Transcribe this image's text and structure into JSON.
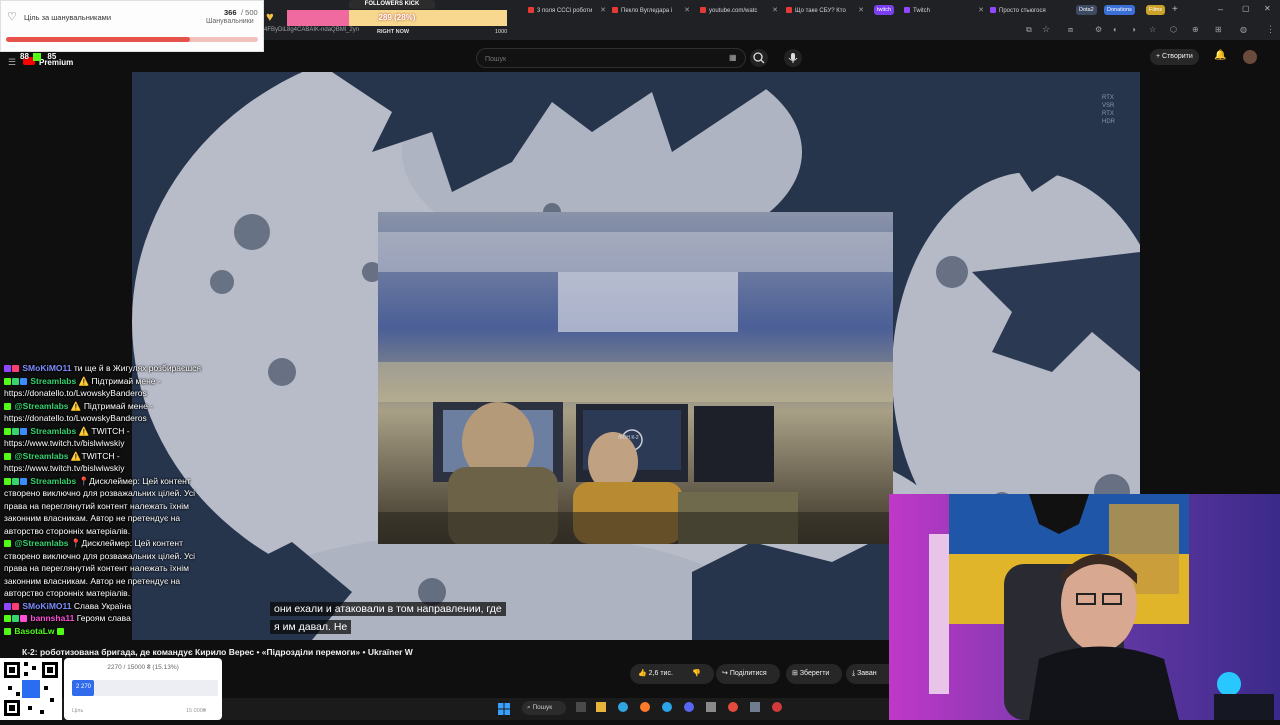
{
  "browser": {
    "tabs": [
      {
        "label": "3 поля СССі роботи",
        "icon_color": "#e53935"
      },
      {
        "label": "Пекло Вугледара і",
        "icon_color": "#e53935"
      },
      {
        "label": "youtube.com/watc",
        "icon_color": "#e53935"
      },
      {
        "label": "Що таке СБУ? Кто",
        "icon_color": "#e53935"
      },
      {
        "label": "Twitch",
        "icon_color": "#9146ff"
      },
      {
        "label": "Просто стьюгося",
        "icon_color": "#9146ff"
      }
    ],
    "tab_pills": [
      {
        "label": "twitch",
        "color": "#7b3ff2"
      },
      {
        "label": "Dota2",
        "color": "#3c4a62"
      },
      {
        "label": "Donations",
        "color": "#3a6fd8"
      },
      {
        "label": "Films",
        "color": "#c9a227"
      }
    ],
    "address_fragment": "4FByDiL8g4CABAIK-ndaQBMl_2yn"
  },
  "youtube": {
    "logo_text": "Premium",
    "logo_counters": [
      "88",
      "85"
    ],
    "search": {
      "placeholder": "Пошук"
    },
    "create_label": "Створити",
    "video_title": "К-2: роботизована бригада, де командує Кирило Верес • «Підрозділи перемоги» • Ukraїner W",
    "subtitle_lines": [
      "они ехали и атаковали в том направлении, где",
      "я им давал. Не"
    ],
    "actions": {
      "like_count": "2,6 тис.",
      "share_label": "Поділитися",
      "save_label": "Зберегти",
      "download_label": "Заван"
    },
    "rtx_badges": [
      "RTX",
      "VSR",
      "RTX",
      "HDR"
    ],
    "emblem_text": "ЛЮН К-2"
  },
  "goal_widget": {
    "title": "Ціль за шанувальниками",
    "count": "366",
    "total": "/ 500",
    "subtitle": "Шанувальники",
    "progress": 0.732
  },
  "followers_widget": {
    "label": "FOLLOWERS KICK",
    "value": "289 (28%)",
    "progress": 0.28,
    "left_label": "RIGHT NOW",
    "right_label": "1000"
  },
  "chat": [
    {
      "user": "SMoKiMO11",
      "color": "#7e8cff",
      "text": "ти ще й в Жигулях розбираєшся",
      "badges": [
        "#9146ff",
        "#ff3d77"
      ]
    },
    {
      "user": "Streamlabs",
      "color": "#36d36f",
      "text": "⚠️ Підтримай мене - https://donatello.to/LwowskyBanderos",
      "badges": [
        "#53fc18",
        "#36d36f",
        "#3a8cff"
      ]
    },
    {
      "user": "@Streamlabs",
      "color": "#36d36f",
      "text": "⚠️ Підтримай мене - https://donatello.to/LwowskyBanderos",
      "badges": [
        "#53fc18"
      ]
    },
    {
      "user": "Streamlabs",
      "color": "#36d36f",
      "text": "⚠️ TWITCH - https://www.twitch.tv/bislwiwskiy",
      "badges": [
        "#53fc18",
        "#36d36f",
        "#3a8cff"
      ]
    },
    {
      "user": "@Streamlabs",
      "color": "#36d36f",
      "text": "⚠️TWITCH - https://www.twitch.tv/bislwiwskiy",
      "badges": [
        "#53fc18"
      ]
    },
    {
      "user": "Streamlabs",
      "color": "#36d36f",
      "text": "📍Дисклеймер: Цей контент створено виключно для розважальних цілей. Усі права на переглянутий контент належать їхнім законним власникам. Автор не претендує на авторство сторонніх матеріалів.",
      "badges": [
        "#53fc18",
        "#36d36f",
        "#3a8cff"
      ]
    },
    {
      "user": "@Streamlabs",
      "color": "#36d36f",
      "text": "📍Дисклеймер: Цей контент створено виключно для розважальних цілей. Усі права на переглянутий контент належать їхнім законним власникам. Автор не претендує на авторство сторонніх матеріалів.",
      "badges": [
        "#53fc18"
      ]
    },
    {
      "user": "SMoKiMO11",
      "color": "#7e8cff",
      "text": "Слава Україна",
      "badges": [
        "#9146ff",
        "#ff3d77"
      ]
    },
    {
      "user": "bannsha11",
      "color": "#ff4fd8",
      "text": "Героям слава",
      "badges": [
        "#53fc18",
        "#36d36f",
        "#ff4fd8"
      ]
    },
    {
      "user": "BasotaLw",
      "color": "#53fc18",
      "text": "",
      "badges": [
        "#53fc18"
      ]
    }
  ],
  "donation_widget": {
    "amount": "2270 / 15000 ₴ (15.13%)",
    "bar_value": "2 270",
    "progress": 0.1513,
    "goal_label": "Ціль",
    "goal_max": "15 000₴"
  },
  "taskbar": {
    "search_label": "Пошук"
  },
  "colors": {
    "youtube_red": "#ff0000",
    "kick_green": "#53fc18",
    "twitch_purple": "#9146ff",
    "goal_bar": "#e5534b",
    "followers_bar": "#f06aa0"
  }
}
